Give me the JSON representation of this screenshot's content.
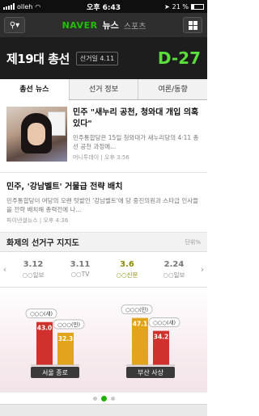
{
  "status_bar": {
    "carrier": "olleh",
    "time": "오후 6:43",
    "battery": "21 %"
  },
  "navbar": {
    "brand": "NAVER",
    "section": "뉴스",
    "section_alt": "스포츠"
  },
  "hero": {
    "title": "제19대 총선",
    "election_date": "선거일 4.11",
    "dday": "D-27"
  },
  "tabs": [
    {
      "label": "총선 뉴스",
      "active": true
    },
    {
      "label": "선거 정보",
      "active": false
    },
    {
      "label": "여론/동향",
      "active": false
    }
  ],
  "articles": [
    {
      "title": "민주 \"새누리 공천, 청와대 개입 의혹 있다\"",
      "body": "민주통합당은 15일 청와대가 새누리당의 4·11 총선 공천 과정에...",
      "source": "머니투데이",
      "time": "오후 3:56"
    },
    {
      "title": "민주, '강남벨트' 거물급 전략 배치",
      "body": "민주통합당이 여당의 오랜 텃밭인 '강남벨트'에 당 중진의원과 스타급 인사들을 전략 배치해 총력전에 나...",
      "source": "파이낸셜뉴스",
      "time": "오후 4:36"
    }
  ],
  "poll": {
    "title": "화제의 선거구 지지도",
    "unit": "단위%",
    "dates": [
      {
        "date": "3.12",
        "source": "○○일보",
        "active": false
      },
      {
        "date": "3.11",
        "source": "○○TV",
        "active": false
      },
      {
        "date": "3.6",
        "source": "○○신문",
        "active": true
      },
      {
        "date": "2.24",
        "source": "○○일보",
        "active": false
      }
    ]
  },
  "chart_data": {
    "type": "bar",
    "categories": [
      "서울 종로",
      "부산 사상"
    ],
    "groups": [
      {
        "category": "서울 종로",
        "bars": [
          {
            "label": "○○○(새)",
            "value": 43.0,
            "color": "#d0312d"
          },
          {
            "label": "○○○(민)",
            "value": 32.3,
            "color": "#e2a41a"
          }
        ]
      },
      {
        "category": "부산 사상",
        "bars": [
          {
            "label": "○○○(민)",
            "value": 47.1,
            "color": "#e2a41a"
          },
          {
            "label": "○○○(새)",
            "value": 34.2,
            "color": "#d0312d"
          }
        ]
      }
    ]
  },
  "pager": {
    "pages": 3,
    "current": 1
  },
  "colors": {
    "accent_green": "#20c000",
    "dday_green": "#5adf3a",
    "bar_red": "#d0312d",
    "bar_yellow": "#e2a41a"
  },
  "icons": {
    "search": "search-icon",
    "menu": "grid-menu-icon",
    "prev": "chevron-left-icon",
    "next": "chevron-right-icon"
  }
}
